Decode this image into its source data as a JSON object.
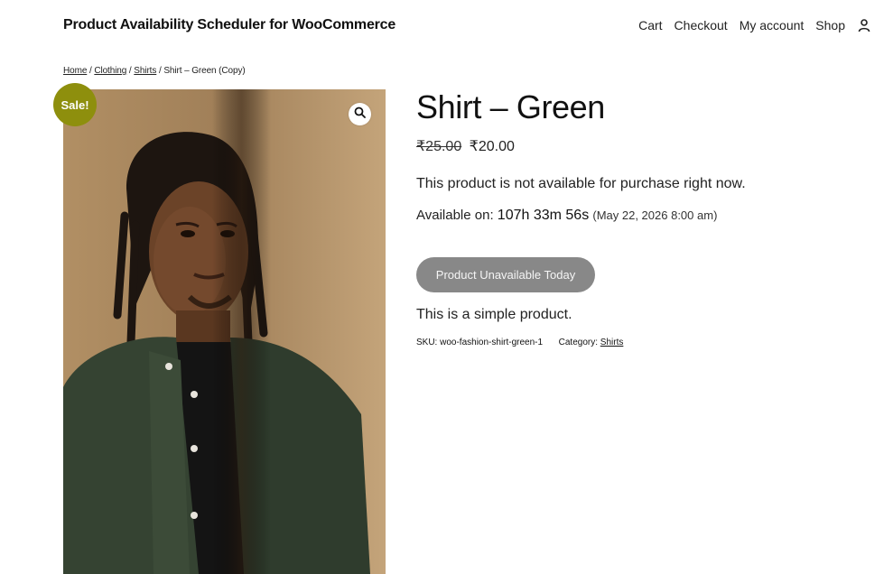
{
  "header": {
    "site_title": "Product Availability Scheduler for WooCommerce",
    "nav": [
      "Cart",
      "Checkout",
      "My account",
      "Shop"
    ],
    "account_icon": "user-icon"
  },
  "breadcrumb": {
    "items": [
      "Home",
      "Clothing",
      "Shirts"
    ],
    "current": "Shirt – Green (Copy)",
    "separator": "/"
  },
  "gallery": {
    "sale_badge": "Sale!",
    "zoom_icon": "magnifier-icon",
    "badge_color": "#8e8f0d"
  },
  "product": {
    "title": "Shirt – Green",
    "old_price": "₹25.00",
    "price": "₹20.00",
    "notice": "This product is not available for purchase right now.",
    "available_label": "Available on:",
    "countdown": "107h 33m 56s",
    "available_date": "(May 22, 2026 8:00 am)",
    "button_label": "Product Unavailable Today",
    "button_color": "#888888",
    "short_description": "This is a simple product.",
    "sku_label": "SKU:",
    "sku": "woo-fashion-shirt-green-1",
    "category_label": "Category:",
    "category": "Shirts"
  }
}
